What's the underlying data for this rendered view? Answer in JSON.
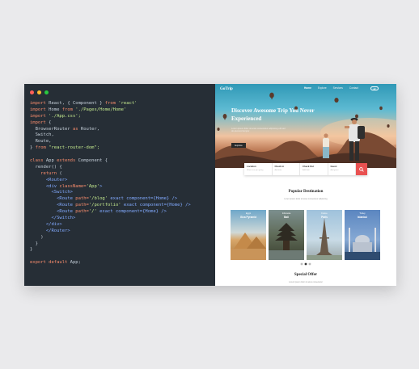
{
  "editor": {
    "window_dots": [
      "#ff5f57",
      "#febc2e",
      "#28c840"
    ],
    "lines": [
      [
        {
          "t": "import",
          "c": "kw"
        },
        {
          "t": " React, { Component } ",
          "c": "cm"
        },
        {
          "t": "from",
          "c": "kw"
        },
        {
          "t": " 'react'",
          "c": "st"
        }
      ],
      [
        {
          "t": "import",
          "c": "kw"
        },
        {
          "t": " Home ",
          "c": "cm"
        },
        {
          "t": "from",
          "c": "kw"
        },
        {
          "t": " './Pages/Home/Home'",
          "c": "st"
        }
      ],
      [
        {
          "t": "import",
          "c": "kw"
        },
        {
          "t": " './App.css';",
          "c": "st"
        }
      ],
      [
        {
          "t": "import",
          "c": "kw"
        },
        {
          "t": " {",
          "c": "cm"
        }
      ],
      [
        {
          "t": "  BrowserRouter ",
          "c": "cm"
        },
        {
          "t": "as",
          "c": "kw"
        },
        {
          "t": " Router,",
          "c": "cm"
        }
      ],
      [
        {
          "t": "  Switch,",
          "c": "cm"
        }
      ],
      [
        {
          "t": "  Route,",
          "c": "cm"
        }
      ],
      [
        {
          "t": "} ",
          "c": "cm"
        },
        {
          "t": "from",
          "c": "kw"
        },
        {
          "t": " \"react-router-dom\";",
          "c": "st"
        }
      ],
      [],
      [
        {
          "t": "class",
          "c": "kw"
        },
        {
          "t": " App ",
          "c": "cm"
        },
        {
          "t": "extends",
          "c": "kw"
        },
        {
          "t": " Component {",
          "c": "cm"
        }
      ],
      [
        {
          "t": "  render() {",
          "c": "cm"
        }
      ],
      [
        {
          "t": "    return",
          "c": "kw"
        },
        {
          "t": " (",
          "c": "cm"
        }
      ],
      [
        {
          "t": "      <Router>",
          "c": "tg"
        }
      ],
      [
        {
          "t": "      <div ",
          "c": "tg"
        },
        {
          "t": "className=",
          "c": "kw"
        },
        {
          "t": "'App'",
          "c": "st"
        },
        {
          "t": ">",
          "c": "tg"
        }
      ],
      [
        {
          "t": "        <Switch>",
          "c": "tg"
        }
      ],
      [
        {
          "t": "          <Route ",
          "c": "tg"
        },
        {
          "t": "path=",
          "c": "kw"
        },
        {
          "t": "'/blog'",
          "c": "st"
        },
        {
          "t": " exact component={Home} />",
          "c": "tg"
        }
      ],
      [
        {
          "t": "          <Route ",
          "c": "tg"
        },
        {
          "t": "path=",
          "c": "kw"
        },
        {
          "t": "'/portfolio'",
          "c": "st"
        },
        {
          "t": " exact component={Home} />",
          "c": "tg"
        }
      ],
      [
        {
          "t": "          <Route ",
          "c": "tg"
        },
        {
          "t": "path=",
          "c": "kw"
        },
        {
          "t": "'/'",
          "c": "st"
        },
        {
          "t": " exact component={Home} />",
          "c": "tg"
        }
      ],
      [
        {
          "t": "        </Switch>",
          "c": "tg"
        }
      ],
      [
        {
          "t": "      </div>",
          "c": "tg"
        }
      ],
      [
        {
          "t": "      </Router>",
          "c": "tg"
        }
      ],
      [
        {
          "t": "    )",
          "c": "cm"
        }
      ],
      [
        {
          "t": "  }",
          "c": "cm"
        }
      ],
      [
        {
          "t": "}",
          "c": "cm"
        }
      ],
      [],
      [
        {
          "t": "export default",
          "c": "kw"
        },
        {
          "t": " App;",
          "c": "cm"
        }
      ]
    ]
  },
  "site": {
    "logo": "GoTrip",
    "nav": [
      "Home",
      "Explore",
      "Services",
      "Contact"
    ],
    "hero_title": "Discover Awesome Trip You Never Experienced",
    "hero_sub": "Lorem ipsum dolor sit amet consectetur adipiscing elit sed do eiusmod tempor",
    "explore_label": "Explore",
    "search_fields": [
      {
        "label": "Location",
        "placeholder": "Where are you going"
      },
      {
        "label": "Check in",
        "placeholder": "Add date"
      },
      {
        "label": "Check Out",
        "placeholder": "Add date"
      },
      {
        "label": "Guest",
        "placeholder": "Add guest"
      }
    ],
    "popular_title": "Popular Destination",
    "popular_sub": "Lorem ipsum dolor sit amet consectetur adipiscing",
    "destinations": [
      {
        "country": "Egypt",
        "city": "Giza Pyramid"
      },
      {
        "country": "Indonesia",
        "city": "Bali"
      },
      {
        "country": "France",
        "city": "Paris"
      },
      {
        "country": "Turkey",
        "city": "Istanbul"
      }
    ],
    "special_title": "Special Offer",
    "special_sub": "Lorem ipsum dolor sit amet consectetur",
    "accent": "#e95151"
  }
}
